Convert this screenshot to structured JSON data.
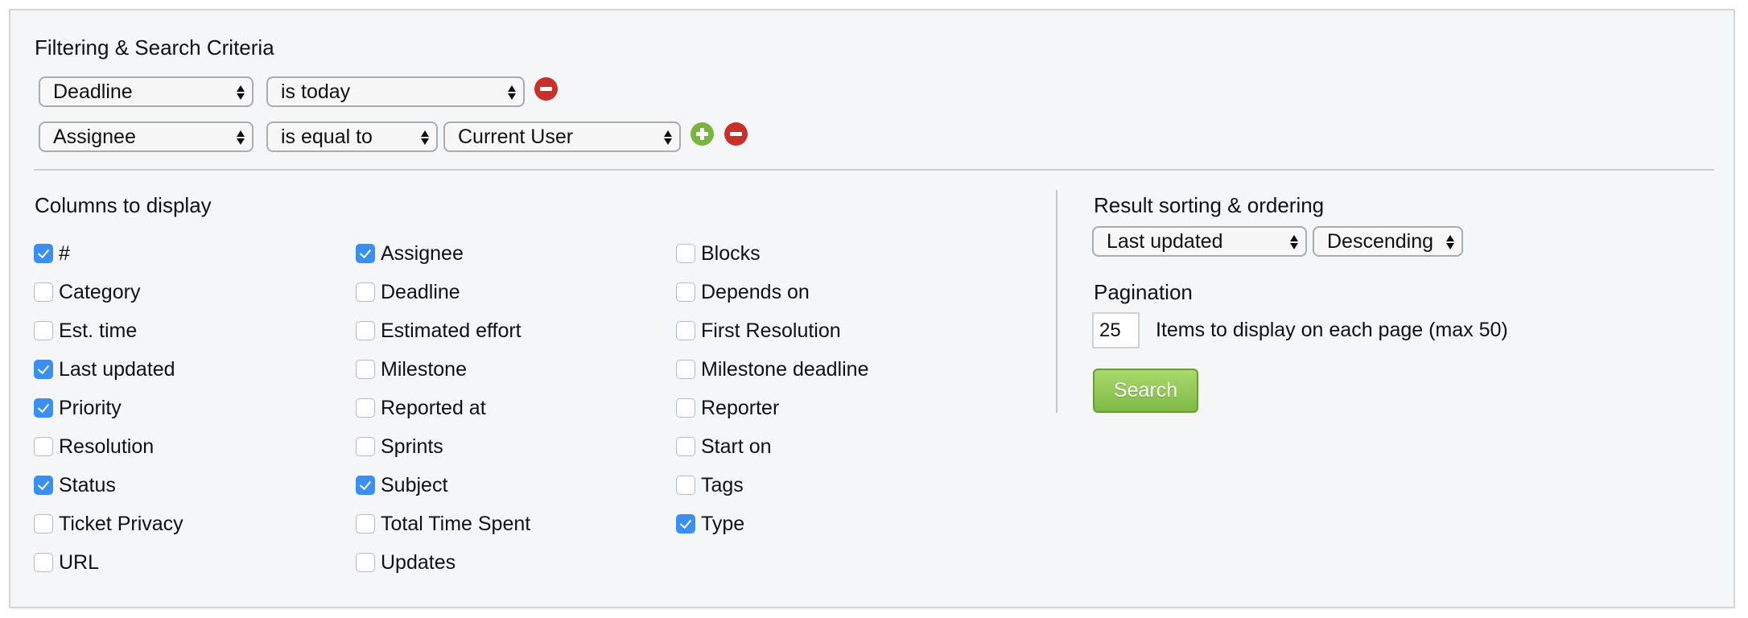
{
  "filters": {
    "title": "Filtering & Search Criteria",
    "rows": [
      {
        "field": "Deadline",
        "operator": "is today",
        "value": null,
        "actions": [
          "remove"
        ]
      },
      {
        "field": "Assignee",
        "operator": "is equal to",
        "value": "Current User",
        "actions": [
          "add",
          "remove"
        ]
      }
    ],
    "icons": {
      "add": "plus-circle-icon",
      "remove": "minus-circle-icon"
    },
    "colors": {
      "add": "#79b342",
      "remove": "#c8302a"
    }
  },
  "columns": {
    "title": "Columns to display",
    "items": [
      {
        "label": "#",
        "checked": true
      },
      {
        "label": "Category",
        "checked": false
      },
      {
        "label": "Est. time",
        "checked": false
      },
      {
        "label": "Last updated",
        "checked": true
      },
      {
        "label": "Priority",
        "checked": true
      },
      {
        "label": "Resolution",
        "checked": false
      },
      {
        "label": "Status",
        "checked": true
      },
      {
        "label": "Ticket Privacy",
        "checked": false
      },
      {
        "label": "URL",
        "checked": false
      },
      {
        "label": "Assignee",
        "checked": true
      },
      {
        "label": "Deadline",
        "checked": false
      },
      {
        "label": "Estimated effort",
        "checked": false
      },
      {
        "label": "Milestone",
        "checked": false
      },
      {
        "label": "Reported at",
        "checked": false
      },
      {
        "label": "Sprints",
        "checked": false
      },
      {
        "label": "Subject",
        "checked": true
      },
      {
        "label": "Total Time Spent",
        "checked": false
      },
      {
        "label": "Updates",
        "checked": false
      },
      {
        "label": "Blocks",
        "checked": false
      },
      {
        "label": "Depends on",
        "checked": false
      },
      {
        "label": "First Resolution",
        "checked": false
      },
      {
        "label": "Milestone deadline",
        "checked": false
      },
      {
        "label": "Reporter",
        "checked": false
      },
      {
        "label": "Start on",
        "checked": false
      },
      {
        "label": "Tags",
        "checked": false
      },
      {
        "label": "Type",
        "checked": true
      }
    ]
  },
  "sorting": {
    "title": "Result sorting & ordering",
    "sort_by": "Last updated",
    "order": "Descending"
  },
  "pagination": {
    "title": "Pagination",
    "per_page": "25",
    "description": "Items to display on each page (max 50)"
  },
  "search_button": {
    "label": "Search",
    "color": "#80b945"
  },
  "accent_color": "#3a8ff2"
}
